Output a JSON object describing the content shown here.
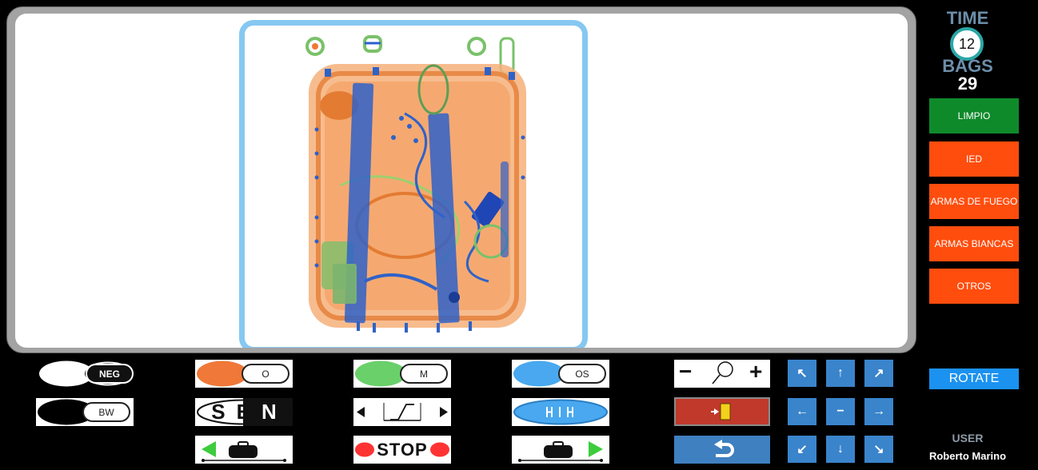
{
  "hud": {
    "time_label": "TIME",
    "time_value": "12",
    "bags_label": "BAGS",
    "bags_value": "29"
  },
  "categories": [
    {
      "label": "LIMPIO",
      "color": "#0f8a2a"
    },
    {
      "label": "IED",
      "color": "#ff4d0d"
    },
    {
      "label": "ARMAS DE FUEGO",
      "color": "#ff4d0d"
    },
    {
      "label": "ARMAS BIANCAS",
      "color": "#ff4d0d"
    },
    {
      "label": "OTROS",
      "color": "#ff4d0d"
    }
  ],
  "rotate_label": "ROTATE",
  "user": {
    "label": "USER",
    "name": "Roberto Marino"
  },
  "toolbar": {
    "neg_label": "NEG",
    "bw_label": "BW",
    "organic_label": "O",
    "metal_label": "M",
    "os_label": "OS",
    "sen_label": "SEN",
    "stop_label": "STOP",
    "zoom_minus": "−",
    "zoom_plus": "+"
  },
  "icons": {
    "neg": "neg-filter-icon",
    "bw": "bw-filter-icon",
    "organic": "organic-filter-icon",
    "metal": "metal-filter-icon",
    "os": "os-filter-icon",
    "sen": "sen-filter-icon",
    "contrast": "contrast-slider-icon",
    "hi": "hi-filter-icon",
    "belt_back": "belt-backward-icon",
    "stop": "stop-belt-icon",
    "belt_forward": "belt-forward-icon",
    "zoom": "magnifier-icon",
    "exit": "exit-door-icon",
    "undo": "undo-arrow-icon"
  },
  "colors": {
    "organic": "#f07838",
    "metal": "#6ad06a",
    "os": "#49a8ef",
    "accent_blue": "#3a84cb",
    "frame_blue": "#86c8f2"
  }
}
